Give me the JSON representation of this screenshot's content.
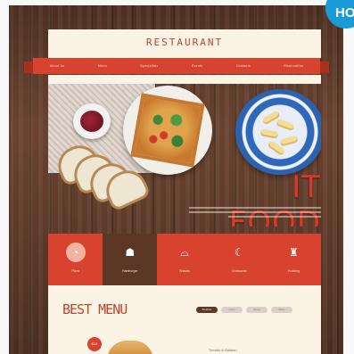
{
  "header": {
    "logo": "RESTAURANT"
  },
  "nav": {
    "items": [
      "About Us",
      "Menu",
      "Specialties",
      "Events",
      "Contacts",
      "Reservation"
    ]
  },
  "hero": {
    "title": "IT FOOD"
  },
  "features": [
    {
      "label": "Pizza",
      "icon": "pizza-icon",
      "glyph": "◔"
    },
    {
      "label": "Hamburger",
      "icon": "burger-icon",
      "glyph": "☗"
    },
    {
      "label": "Snacks",
      "icon": "cloche-icon",
      "glyph": "⌓"
    },
    {
      "label": "Croissants",
      "icon": "croissant-icon",
      "glyph": "☾"
    },
    {
      "label": "Pudding",
      "icon": "cup-icon",
      "glyph": "♜"
    }
  ],
  "menu": {
    "title": "BEST MENU",
    "tabs": [
      "Breakfast",
      "Lunch",
      "Dinner",
      "Drinks",
      "Desserts"
    ],
    "dish_badge": "$12",
    "dish_name": "Tomato & Salmon"
  },
  "badge": {
    "text": "HO"
  },
  "colors": {
    "accent": "#d8432f",
    "dark_brown": "#5c3726",
    "cream": "#fbf3e4",
    "hot_badge": "#1a9ad6"
  }
}
